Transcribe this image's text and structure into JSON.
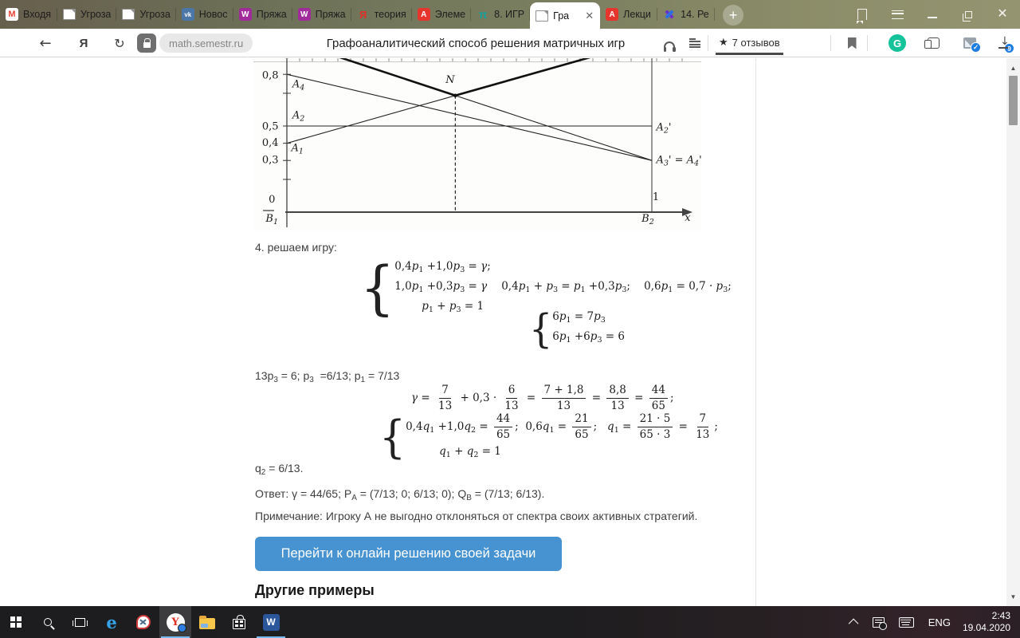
{
  "browser": {
    "tabs": [
      {
        "label": "Входя",
        "icon": "gmail"
      },
      {
        "label": "Угроза",
        "icon": "page"
      },
      {
        "label": "Угроза",
        "icon": "page"
      },
      {
        "label": "Новос",
        "icon": "vk"
      },
      {
        "label": "Пряжа",
        "icon": "wb"
      },
      {
        "label": "Пряжа",
        "icon": "wb"
      },
      {
        "label": "теория",
        "icon": "yandex"
      },
      {
        "label": "Элеме",
        "icon": "pdf"
      },
      {
        "label": "8. ИГР",
        "icon": "pi"
      },
      {
        "label": "Гра",
        "icon": "page",
        "active": true
      },
      {
        "label": "Лекци",
        "icon": "pdf"
      },
      {
        "label": "14. Ре",
        "icon": "pin"
      }
    ],
    "icon_defs": {
      "gmail": {
        "glyph": "M",
        "fg": "#e94335",
        "bg": "#ffffff",
        "size": "11px"
      },
      "vk": {
        "glyph": "vk",
        "fg": "#ffffff",
        "bg": "#4a76a8",
        "size": "8px"
      },
      "wb": {
        "glyph": "W",
        "fg": "#ffffff",
        "bg": "#a12b9b",
        "size": "10px"
      },
      "yandex": {
        "glyph": "Я",
        "fg": "#e02f26",
        "bg": "transparent",
        "size": "13px"
      },
      "pdf": {
        "glyph": "A",
        "fg": "#ffffff",
        "bg": "#e5352c",
        "size": "10px"
      },
      "pi": {
        "glyph": "π",
        "fg": "#12a3a0",
        "bg": "transparent",
        "size": "14px"
      }
    },
    "new_tab_plus": "+",
    "close_glyph": "✕",
    "toolbar": {
      "url": "math.semestr.ru",
      "page_title": "Графоаналитический способ решения матричных игр",
      "reviews_label": "7 отзывов",
      "star": "★",
      "back_glyph": "←",
      "refresh_glyph": "↻",
      "yandex_glyph": "Я",
      "grammarly_glyph": "G",
      "downloads_badge": "9"
    }
  },
  "page": {
    "step_label": "4. решаем игру:",
    "eq1": {
      "rows": [
        "0,4p_1_ +1,0p_3_ = γ;",
        "1,0p_1_ +0,3p_3_ = γ",
        "p_1_ + p_3_ = 1"
      ],
      "side": "0,4p_1_ + p_3_ = p_1_ +0,3p_3_;    0,6p_1_ = 0,7 · p_3_;"
    },
    "eq2": {
      "rows": [
        "6p_1_ = 7p_3_",
        "6p_1_ +6p_3_ = 6"
      ]
    },
    "line_13p": "13p_3_ = 6; p_3_  =6/13; p_1_ = 7/13",
    "eq3": [
      "γ = ",
      [
        "7",
        "13"
      ],
      " + 0,3 · ",
      [
        "6",
        "13"
      ],
      " = ",
      [
        "7 + 1,8",
        "13"
      ],
      " = ",
      [
        "8,8",
        "13"
      ],
      " = ",
      [
        "44",
        "65"
      ],
      ";"
    ],
    "eq4": {
      "row1": [
        "0,4q_1_ +1,0q_2_ = ",
        [
          "44",
          "65"
        ],
        ";"
      ],
      "side": [
        "  0,6q_1_ = ",
        [
          "21",
          "65"
        ],
        ";   q_1_ = ",
        [
          "21 · 5",
          "65 · 3"
        ],
        " = ",
        [
          "7",
          "13"
        ],
        ";"
      ],
      "row2": "q_1_ + q_2_ = 1"
    },
    "q2_line": "q_2_ = 6/13.",
    "answer": "Ответ: γ = 44/65; P_A_ = (7/13; 0; 6/13; 0); Q_B_ = (7/13; 6/13).",
    "note": "Примечание: Игроку А не выгодно отклоняться от спектра своих активных стратегий.",
    "solve_button": "Перейти к онлайн решению своей задачи",
    "other_examples": "Другие примеры"
  },
  "chart_data": {
    "type": "line",
    "description": "Graphical solution of a matrix game: payoff lines of strategies A1–A4 of player A versus mixed strategy x of player B; bold upper envelope of active strategies A1 and A3 with minimum at point N",
    "x_axis": {
      "label": "x",
      "range": [
        0,
        1
      ],
      "tick_labels": [
        "0",
        "1"
      ],
      "endpoint_labels": [
        "B_1_",
        "B_2_"
      ]
    },
    "y_axis": {
      "tick_labels": [
        "0,8",
        "0,5",
        "0,4",
        "0,3",
        "0"
      ],
      "tick_values": [
        0.8,
        0.69,
        0.5,
        0.4,
        0.3,
        0.19
      ]
    },
    "lines": [
      {
        "name": "A1",
        "from": [
          0,
          0.4
        ],
        "to": [
          1,
          1.0
        ]
      },
      {
        "name": "A2",
        "from": [
          0,
          0.5
        ],
        "to": [
          1,
          0.5
        ]
      },
      {
        "name": "A3",
        "from": [
          0,
          1.0
        ],
        "to": [
          1,
          0.3
        ]
      },
      {
        "name": "A4",
        "from": [
          0,
          0.8
        ],
        "to": [
          1,
          0.3
        ]
      }
    ],
    "envelope_bold": [
      [
        0,
        1.0
      ],
      [
        0.4615,
        0.677
      ],
      [
        1,
        1.0
      ]
    ],
    "point_N": {
      "x": 0.4615,
      "y": 0.677,
      "label": "N"
    },
    "dashed_drop_x": 0.4615,
    "labels": [
      {
        "t": "0,8",
        "x": -0.068,
        "y": 0.775
      },
      {
        "t": "A_4_",
        "x": 0.015,
        "y": 0.725
      },
      {
        "t": "A_2_",
        "x": 0.015,
        "y": 0.545
      },
      {
        "t": "0,5",
        "x": -0.068,
        "y": 0.48
      },
      {
        "t": "0,4",
        "x": -0.068,
        "y": 0.385
      },
      {
        "t": "A_1_",
        "x": 0.012,
        "y": 0.355
      },
      {
        "t": "0,3",
        "x": -0.068,
        "y": 0.285
      },
      {
        "t": "0",
        "x": -0.05,
        "y": 0.055
      },
      {
        "t": "B_1_",
        "x": -0.058,
        "y": -0.055
      },
      {
        "t": "N",
        "x": 0.435,
        "y": 0.75
      },
      {
        "t": "A_2_'",
        "x": 1.012,
        "y": 0.475
      },
      {
        "t": "A_3_' = A_4_'",
        "x": 1.012,
        "y": 0.285
      },
      {
        "t": "1",
        "x": 1.002,
        "y": 0.07
      },
      {
        "t": "B_2_",
        "x": 0.972,
        "y": -0.055
      },
      {
        "t": "x",
        "x": 1.09,
        "y": -0.05
      }
    ]
  },
  "taskbar": {
    "tray": {
      "lang": "ENG",
      "time": "2:43",
      "date": "19.04.2020"
    }
  }
}
